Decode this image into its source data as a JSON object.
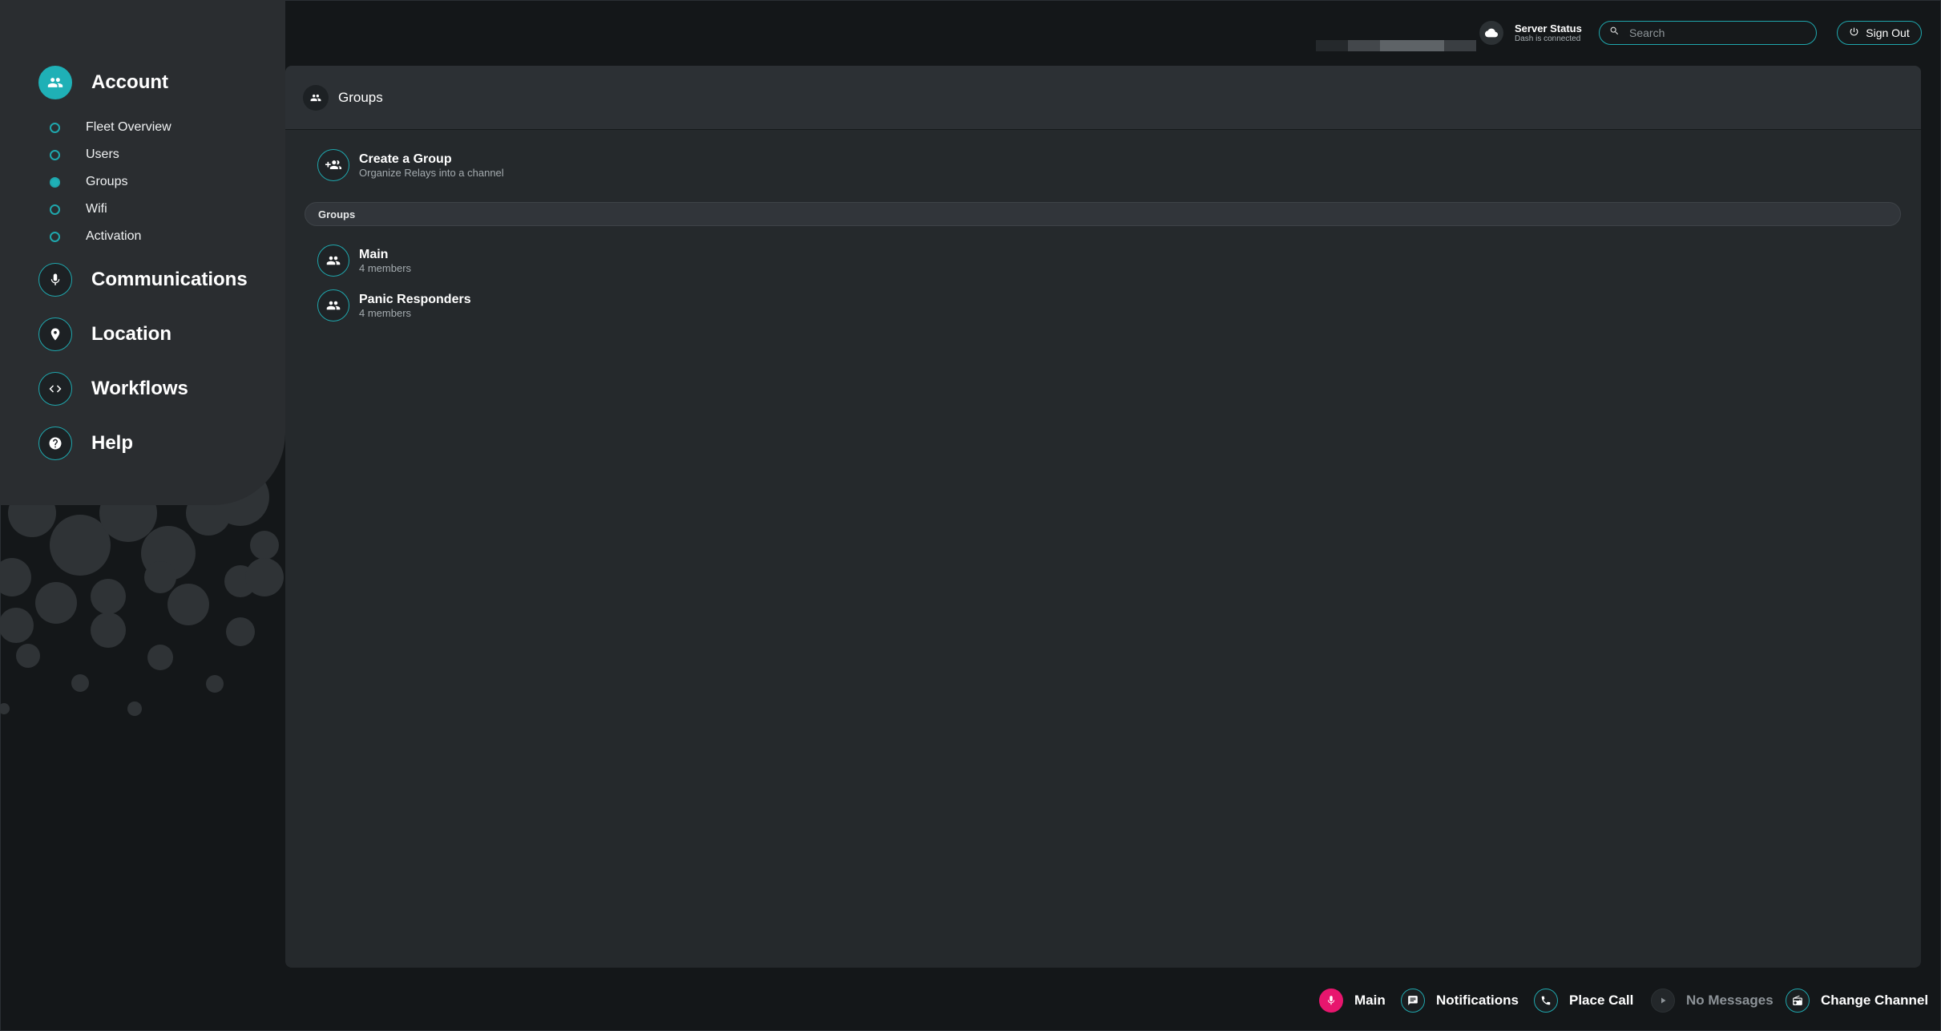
{
  "sidebar": {
    "sections": [
      {
        "label": "Account",
        "icon": "group-icon"
      },
      {
        "label": "Communications",
        "icon": "mic-icon"
      },
      {
        "label": "Location",
        "icon": "location-pin-icon"
      },
      {
        "label": "Workflows",
        "icon": "code-icon"
      },
      {
        "label": "Help",
        "icon": "help-icon"
      }
    ],
    "account_items": [
      {
        "label": "Fleet Overview",
        "selected": false
      },
      {
        "label": "Users",
        "selected": false
      },
      {
        "label": "Groups",
        "selected": true
      },
      {
        "label": "Wifi",
        "selected": false
      },
      {
        "label": "Activation",
        "selected": false
      }
    ]
  },
  "topbar": {
    "server_status_title": "Server Status",
    "server_status_sub": "Dash is connected",
    "search_placeholder": "Search",
    "sign_out_label": "Sign Out"
  },
  "main": {
    "header_title": "Groups",
    "create": {
      "title": "Create a Group",
      "subtitle": "Organize Relays into a channel"
    },
    "section_label": "Groups",
    "groups": [
      {
        "name": "Main",
        "members": "4 members"
      },
      {
        "name": "Panic Responders",
        "members": "4 members"
      }
    ]
  },
  "bottom_bar": {
    "channel": "Main",
    "notifications": "Notifications",
    "place_call": "Place Call",
    "messages": "No Messages",
    "change_channel": "Change Channel"
  },
  "colors": {
    "accent": "#1fb0b6",
    "ptt": "#e8166e",
    "background": "#141719",
    "panel": "#25292c"
  }
}
